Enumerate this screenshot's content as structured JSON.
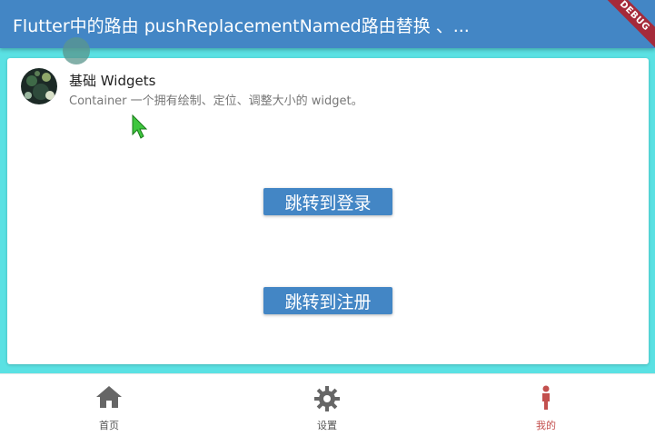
{
  "appbar": {
    "title": "Flutter中的路由 pushReplacementNamed路由替换 、...",
    "debug_label": "DEBUG"
  },
  "list_item": {
    "title": "基础 Widgets",
    "subtitle": "Container 一个拥有绘制、定位、调整大小的 widget。"
  },
  "buttons": {
    "login_label": "跳转到登录",
    "register_label": "跳转到注册"
  },
  "bottom_nav": {
    "items": [
      {
        "label": "首页",
        "icon": "home-icon"
      },
      {
        "label": "设置",
        "icon": "gear-icon"
      },
      {
        "label": "我的",
        "icon": "person-icon",
        "active": true
      }
    ]
  },
  "colors": {
    "primary": "#4386c5",
    "background": "#5ae1e3",
    "active_nav": "#c3504e",
    "inactive_icon": "#666666"
  }
}
